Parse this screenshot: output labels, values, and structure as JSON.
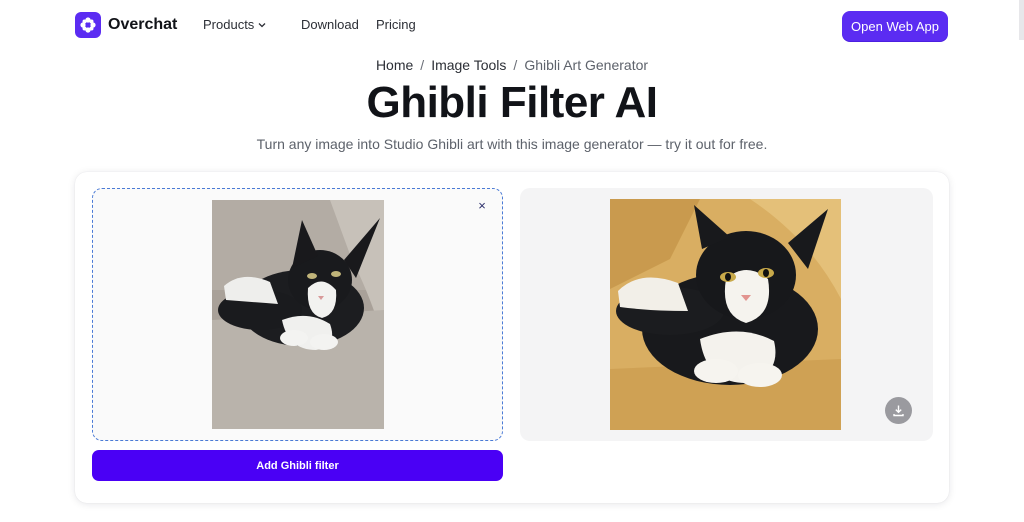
{
  "header": {
    "brand": "Overchat",
    "nav": {
      "products": "Products",
      "download": "Download",
      "pricing": "Pricing"
    },
    "cta": "Open Web App"
  },
  "breadcrumb": {
    "home": "Home",
    "separator": "/",
    "image_tools": "Image Tools",
    "current": "Ghibli Art Generator"
  },
  "hero": {
    "title": "Ghibli Filter AI",
    "subtitle": "Turn any image into Studio Ghibli art with this image generator — try it out for free."
  },
  "tool": {
    "close_glyph": "×",
    "add_button": "Add Ghibli filter",
    "download_icon": "download-icon"
  },
  "colors": {
    "brand": "#5b2cf2",
    "primary_button": "#4a00f5",
    "dropzone_border": "#4b7bd6"
  }
}
